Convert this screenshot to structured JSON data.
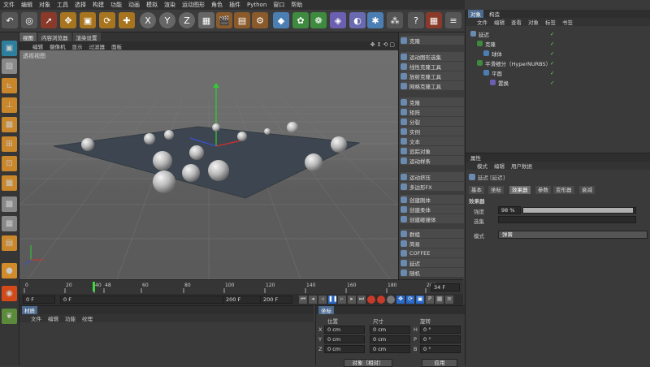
{
  "menubar": [
    "文件",
    "编辑",
    "对象",
    "工具",
    "选择",
    "构建",
    "功能",
    "动画",
    "模拟",
    "渲染",
    "运动图形",
    "角色",
    "插件",
    "Python",
    "窗口",
    "帮助"
  ],
  "viewport": {
    "tabs": [
      "视图",
      "内容浏览器",
      "渲染设置"
    ],
    "menu": [
      "编辑",
      "摄像机",
      "显示",
      "过滤器",
      "面板"
    ],
    "label": "透视视图"
  },
  "mid_panel": {
    "items": [
      "克隆",
      "运动图形选集",
      "线性克隆工具",
      "放射克隆工具",
      "网格克隆工具",
      "克隆",
      "矩阵",
      "分裂",
      "实例",
      "文本",
      "追踪对象",
      "运动样条",
      "运动挤压",
      "多边形FX",
      "创建刚体",
      "创建柔体",
      "创建碰撞体",
      "群组",
      "简易",
      "COFFEE",
      "延迟",
      "随机"
    ]
  },
  "timeline": {
    "ticks": [
      "0",
      "20",
      "40",
      "48",
      "60",
      "80",
      "100",
      "120",
      "140",
      "160",
      "180",
      "200"
    ],
    "current_frame": "34 F",
    "start": "0 F",
    "end": "200 F",
    "range_end": "200 F",
    "range_start": "0 F"
  },
  "materials": {
    "title": "材质",
    "menu": [
      "文件",
      "编辑",
      "功能",
      "纹理"
    ]
  },
  "coords": {
    "title": "坐标",
    "headers": [
      "位置",
      "尺寸",
      "旋转"
    ],
    "rows": [
      {
        "axis": "X",
        "pos": "0 cm",
        "size": "0 cm",
        "rot_label": "H",
        "rot": "0 °"
      },
      {
        "axis": "Y",
        "pos": "0 cm",
        "size": "0 cm",
        "rot_label": "P",
        "rot": "0 °"
      },
      {
        "axis": "Z",
        "pos": "0 cm",
        "size": "0 cm",
        "rot_label": "B",
        "rot": "0 °"
      }
    ],
    "mode": "对象（相对）",
    "apply": "应用"
  },
  "objects_panel": {
    "tabs": [
      "对象",
      "构造"
    ],
    "menu": [
      "文件",
      "编辑",
      "查看",
      "对象",
      "标签",
      "书签"
    ],
    "tree": [
      {
        "name": "延迟",
        "indent": 0
      },
      {
        "name": "克隆",
        "indent": 1
      },
      {
        "name": "球体",
        "indent": 2
      },
      {
        "name": "平滑细分（HyperNURBS）",
        "indent": 1
      },
      {
        "name": "平面",
        "indent": 2
      },
      {
        "name": "置换",
        "indent": 3
      }
    ]
  },
  "attributes_panel": {
    "title": "属性",
    "menu": [
      "模式",
      "编辑",
      "用户数据"
    ],
    "object_label": "延迟 [延迟]",
    "tabs": [
      "基本",
      "坐标",
      "效果器",
      "参数",
      "变形器",
      "衰减"
    ],
    "active_tab": "效果器",
    "section": "效果器",
    "strength_label": "强度",
    "strength_value": "98 %",
    "strength_fraction": 0.98,
    "select_label": "选集",
    "mode_label": "模式",
    "mode_value": "弹簧"
  },
  "colors": {
    "accent_blue": "#4c6a8e",
    "slider_fill": "#b0b0b0"
  }
}
